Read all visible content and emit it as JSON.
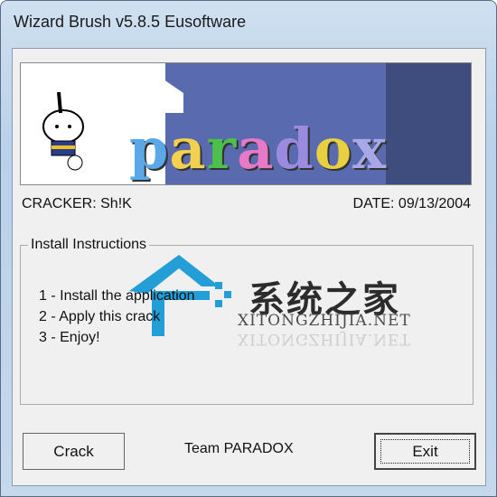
{
  "window": {
    "title": "Wizard Brush v5.8.5 Eusoftware"
  },
  "banner": {
    "logo_text": "paradox"
  },
  "info": {
    "cracker": "CRACKER: Sh!K",
    "date": "DATE: 09/13/2004"
  },
  "instructions": {
    "label": "Install Instructions",
    "steps": [
      "1 - Install the application",
      "2 - Apply this crack",
      "3 - Enjoy!"
    ]
  },
  "watermark": {
    "chinese": "系统之家",
    "site": "XITONGZHIJIA.NET"
  },
  "footer": {
    "crack_label": "Crack",
    "team": "Team PARADOX",
    "exit_label": "Exit"
  },
  "colors": {
    "banner_bg": "#5a6aae",
    "watermark_blue": "#1a9ad6"
  }
}
